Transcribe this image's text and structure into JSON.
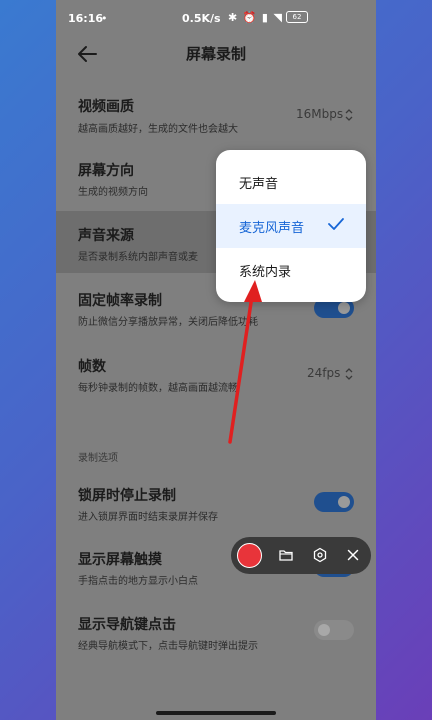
{
  "status_bar": {
    "time": "16:16",
    "dot": "•",
    "net_speed": "0.5K/s",
    "icons_text": "✱ ⏰ ▮ ◥",
    "battery": "62"
  },
  "header": {
    "title": "屏幕录制",
    "back_icon": "back-arrow-icon"
  },
  "settings": {
    "video_quality": {
      "title": "视频画质",
      "subtitle": "越高画质越好，生成的文件也会越大",
      "value": "16Mbps"
    },
    "orientation": {
      "title": "屏幕方向",
      "subtitle": "生成的视频方向"
    },
    "sound_source": {
      "title": "声音来源",
      "subtitle": "是否录制系统内部声音或麦"
    },
    "fixed_fps": {
      "title": "固定帧率录制",
      "subtitle": "防止微信分享播放异常，关闭后降低功耗",
      "enabled": true
    },
    "fps": {
      "title": "帧数",
      "subtitle": "每秒钟录制的帧数，越高画面越流畅",
      "value": "24fps"
    },
    "section_label": "录制选项",
    "lock_stop": {
      "title": "锁屏时停止录制",
      "subtitle": "进入锁屏界面时结束录屏并保存",
      "enabled": true
    },
    "show_touch": {
      "title": "显示屏幕触摸",
      "subtitle": "手指点击的地方显示小白点",
      "enabled": true
    },
    "show_nav": {
      "title": "显示导航键点击",
      "subtitle": "经典导航模式下，点击导航键时弹出提示",
      "enabled": false
    }
  },
  "dropdown": {
    "options": [
      "无声音",
      "麦克风声音",
      "系统内录"
    ],
    "selected_index": 1
  },
  "colors": {
    "accent": "#1766d6",
    "record": "#e8343a",
    "arrow": "#e02020"
  }
}
